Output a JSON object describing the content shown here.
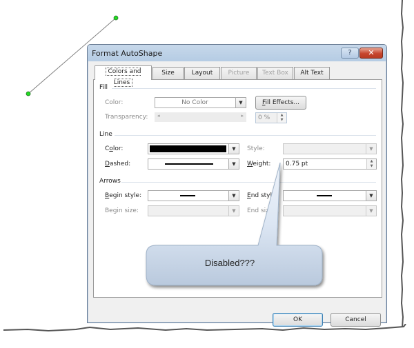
{
  "dialog": {
    "title": "Format AutoShape",
    "help_icon": "question-mark-icon",
    "close_icon": "close-x-icon",
    "tabs": [
      {
        "label": "Colors and Lines",
        "active": true,
        "enabled": true
      },
      {
        "label": "Size",
        "active": false,
        "enabled": true
      },
      {
        "label": "Layout",
        "active": false,
        "enabled": true
      },
      {
        "label": "Picture",
        "active": false,
        "enabled": false
      },
      {
        "label": "Text Box",
        "active": false,
        "enabled": false
      },
      {
        "label": "Alt Text",
        "active": false,
        "enabled": true
      }
    ],
    "fill": {
      "group_label": "Fill",
      "color_label": "Color:",
      "color_value": "No Color",
      "fill_effects_button": "Fill Effects...",
      "transparency_label": "Transparency:",
      "transparency_value": "0 %"
    },
    "line": {
      "group_label": "Line",
      "color_label_pre": "C",
      "color_label_u": "o",
      "color_label_post": "lor:",
      "color_value": "#000000",
      "dashed_label_u": "D",
      "dashed_label_post": "ashed:",
      "style_label": "Style:",
      "weight_label_u": "W",
      "weight_label_post": "eight:",
      "weight_value": "0.75 pt"
    },
    "arrows": {
      "group_label": "Arrows",
      "begin_style_label_u": "B",
      "begin_style_label_post": "egin style:",
      "begin_size_label": "Begin size:",
      "end_style_label_u": "E",
      "end_style_label_post": "nd style:",
      "end_size_label": "End size:"
    },
    "ok_button": "OK",
    "cancel_button": "Cancel"
  },
  "annotation": {
    "callout_text": "Disabled???"
  },
  "colors": {
    "handle_fill": "#22dd22",
    "line_stroke": "#7f7f7f"
  }
}
